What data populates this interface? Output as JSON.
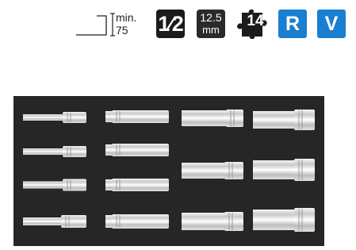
{
  "header": {
    "depth": {
      "min_label": "min.",
      "value": "75",
      "icon": "socket-depth-icon"
    },
    "drive": {
      "label": "1⁄2",
      "icon": "drive-size-icon"
    },
    "size": {
      "line1": "12.5",
      "line2": "mm",
      "icon": "square-drive-mm-icon"
    },
    "pieces": {
      "label": "14",
      "icon": "puzzle-piece-icon"
    },
    "badges": [
      {
        "label": "R",
        "color": "#1a7fd0"
      },
      {
        "label": "V",
        "color": "#1a7fd0"
      }
    ]
  },
  "tray": {
    "icon": "foam-tray-icon",
    "background": "#262626",
    "item_count": 14,
    "items_icon": "deep-socket-icon"
  }
}
